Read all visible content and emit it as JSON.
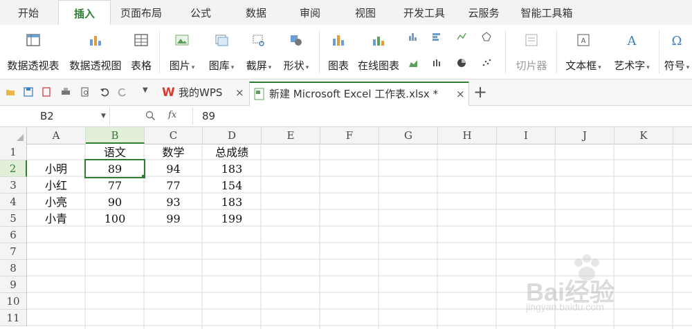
{
  "ribbon_tabs": [
    "开始",
    "插入",
    "页面布局",
    "公式",
    "数据",
    "审阅",
    "视图",
    "开发工具",
    "云服务",
    "智能工具箱"
  ],
  "ribbon_buttons": {
    "pivot_table": "数据透视表",
    "pivot_chart": "数据透视图",
    "table": "表格",
    "picture": "图片",
    "gallery": "图库",
    "screenshot": "截屏",
    "shapes": "形状",
    "chart": "图表",
    "online_chart": "在线图表",
    "slicer": "切片器",
    "textbox": "文本框",
    "wordart": "艺术字",
    "symbol": "符号"
  },
  "doc_tabs": {
    "home": "我的WPS",
    "active": "新建 Microsoft Excel 工作表.xlsx *",
    "close": "×",
    "new_tab": "+"
  },
  "formula_bar": {
    "cell_ref": "B2",
    "fx": "fx",
    "value": "89"
  },
  "columns": [
    "A",
    "B",
    "C",
    "D",
    "E",
    "F",
    "G",
    "H",
    "I",
    "J",
    "K"
  ],
  "rows": [
    "1",
    "2",
    "3",
    "4",
    "5",
    "6",
    "7",
    "8",
    "9",
    "10",
    "11"
  ],
  "cells": {
    "r1": [
      "",
      "语文",
      "数学",
      "总成绩"
    ],
    "r2": [
      "小明",
      "89",
      "94",
      "183"
    ],
    "r3": [
      "小红",
      "77",
      "77",
      "154"
    ],
    "r4": [
      "小亮",
      "90",
      "93",
      "183"
    ],
    "r5": [
      "小青",
      "100",
      "99",
      "199"
    ]
  },
  "watermark": {
    "brand": "Bai经验",
    "url": "jingyan.baidu.com"
  },
  "colors": {
    "accent": "#2f7d32",
    "selection": "#e2efd9"
  }
}
